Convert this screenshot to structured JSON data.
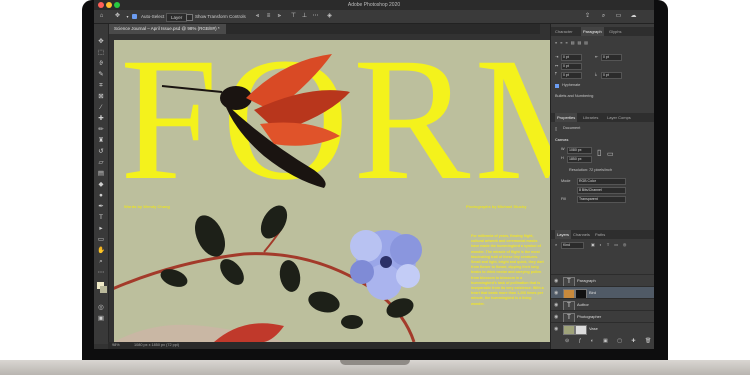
{
  "app": {
    "title": "Adobe Photoshop 2020"
  },
  "options_bar": {
    "auto_select_label": "Auto-Select",
    "auto_select_target": "Layer",
    "show_transform_label": "Show Transform Controls"
  },
  "document": {
    "tab_label": "Science Journal – April Issue.psd @ 98% (RGB/8#) *",
    "zoom": "98%",
    "status_size": "1080 px x 1850 px (72 ppi)"
  },
  "artwork": {
    "headline": "FORM",
    "credit_left": "Words by Wendy Chang",
    "credit_right": "Photographs by Michael Stucky",
    "body_text": "For millennia of years, flowing flight, cultural artwork and ceremonial masks have made the hummingbird a symbol of wonder. The miracle of flight is the most fascinating trait of these tiny creatures. Small and light, bright and quick, they dart from flower to flower, dipping their long beaks to drink nectar and carrying pollen from blossom to blossom in a hummingbird's task of pollination that is inseparable from its very existence. With a heart that beats more than 1,200 times per minute, the hummingbird is a living wonder."
  },
  "panels": {
    "top_tabs": [
      "Character",
      "Paragraph",
      "Glyphs"
    ],
    "paragraph": {
      "indent_left": "0 pt",
      "indent_right": "0 pt",
      "indent_first": "0 pt",
      "space_before": "0 pt",
      "space_after": "0 pt",
      "hyphenate_label": "Hyphenate",
      "bullets_label": "Bullets and Numbering"
    },
    "mid_tabs": [
      "Properties",
      "Libraries",
      "Layer Comps"
    ],
    "properties": {
      "kind": "Document",
      "section": "Canvas",
      "width": "1080 px",
      "height": "1850 px",
      "resolution": "Resolution: 72 pixels/inch",
      "mode_label": "Mode",
      "mode_value": "RGB Color",
      "bit_depth": "8 Bits/Channel",
      "fill_label": "Fill",
      "fill_value": "Transparent"
    },
    "layers_tabs": [
      "Layers",
      "Channels",
      "Paths"
    ],
    "layers_filter": "Kind",
    "layers": [
      {
        "name": "Paragraph",
        "type": "text"
      },
      {
        "name": "Bird",
        "type": "image"
      },
      {
        "name": "Author",
        "type": "text"
      },
      {
        "name": "Photographer",
        "type": "text"
      },
      {
        "name": "Vase",
        "type": "image"
      }
    ]
  },
  "colors": {
    "headline_yellow": "#f4f21c",
    "canvas_bg": "#bcbf9d",
    "bird_orange": "#e0532a",
    "flower_blue": "#9aa6e8"
  }
}
